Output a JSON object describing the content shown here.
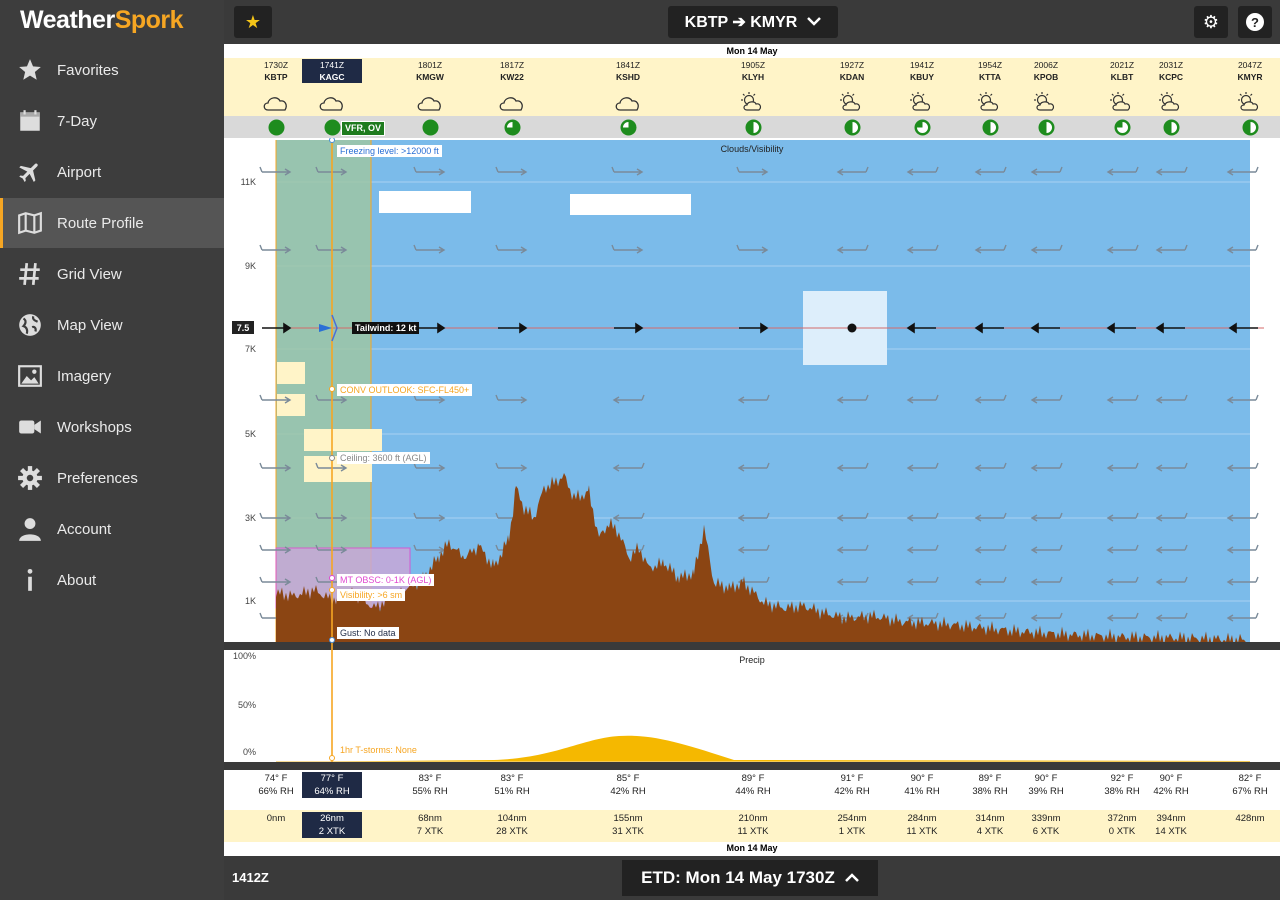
{
  "app": {
    "logo_part1": "Weather",
    "logo_part2": "Spork"
  },
  "sidebar": {
    "items": [
      {
        "label": "Favorites",
        "icon": "star-icon"
      },
      {
        "label": "7-Day",
        "icon": "calendar-icon"
      },
      {
        "label": "Airport",
        "icon": "plane-icon"
      },
      {
        "label": "Route Profile",
        "icon": "map-icon",
        "active": true
      },
      {
        "label": "Grid View",
        "icon": "hash-icon"
      },
      {
        "label": "Map View",
        "icon": "globe-icon"
      },
      {
        "label": "Imagery",
        "icon": "image-icon"
      },
      {
        "label": "Workshops",
        "icon": "video-icon"
      },
      {
        "label": "Preferences",
        "icon": "gear-icon"
      },
      {
        "label": "Account",
        "icon": "user-icon"
      },
      {
        "label": "About",
        "icon": "info-icon"
      }
    ]
  },
  "topbar": {
    "star": "★",
    "route": "KBTP ➔ KMYR",
    "gear": "⚙",
    "help": "?"
  },
  "profile": {
    "date_top": "Mon 14 May",
    "date_bottom": "Mon 14 May",
    "waypoints": [
      {
        "time": "1730Z",
        "code": "KBTP",
        "temp": "74° F",
        "rh": "66% RH",
        "dist": "0nm",
        "xtk": ""
      },
      {
        "time": "1741Z",
        "code": "KAGC",
        "temp": "77° F",
        "rh": "64% RH",
        "dist": "26nm",
        "xtk": "2 XTK",
        "selected": true
      },
      {
        "time": "1801Z",
        "code": "KMGW",
        "temp": "83° F",
        "rh": "55% RH",
        "dist": "68nm",
        "xtk": "7 XTK"
      },
      {
        "time": "1817Z",
        "code": "KW22",
        "temp": "83° F",
        "rh": "51% RH",
        "dist": "104nm",
        "xtk": "28 XTK"
      },
      {
        "time": "1841Z",
        "code": "KSHD",
        "temp": "85° F",
        "rh": "42% RH",
        "dist": "155nm",
        "xtk": "31 XTK"
      },
      {
        "time": "1905Z",
        "code": "KLYH",
        "temp": "89° F",
        "rh": "44% RH",
        "dist": "210nm",
        "xtk": "11 XTK"
      },
      {
        "time": "1927Z",
        "code": "KDAN",
        "temp": "91° F",
        "rh": "42% RH",
        "dist": "254nm",
        "xtk": "1 XTK"
      },
      {
        "time": "1941Z",
        "code": "KBUY",
        "temp": "90° F",
        "rh": "41% RH",
        "dist": "284nm",
        "xtk": "11 XTK"
      },
      {
        "time": "1954Z",
        "code": "KTTA",
        "temp": "89° F",
        "rh": "38% RH",
        "dist": "314nm",
        "xtk": "4 XTK"
      },
      {
        "time": "2006Z",
        "code": "KPOB",
        "temp": "90° F",
        "rh": "39% RH",
        "dist": "339nm",
        "xtk": "6 XTK"
      },
      {
        "time": "2021Z",
        "code": "KLBT",
        "temp": "92° F",
        "rh": "38% RH",
        "dist": "372nm",
        "xtk": "0 XTK"
      },
      {
        "time": "2031Z",
        "code": "KCPC",
        "temp": "90° F",
        "rh": "42% RH",
        "dist": "394nm",
        "xtk": "14 XTK"
      },
      {
        "time": "2047Z",
        "code": "KMYR",
        "temp": "82° F",
        "rh": "67% RH",
        "dist": "428nm",
        "xtk": ""
      }
    ],
    "flight_category": "VFR, OV",
    "cloud_vis_title": "Clouds/Visibility",
    "precip_title": "Precip",
    "altitude_ticks": [
      "11K",
      "9K",
      "7K",
      "5K",
      "3K",
      "1K"
    ],
    "cruise_alt": "7.5",
    "precip_ticks": [
      "100%",
      "50%",
      "0%"
    ],
    "tags": {
      "freezing": "Freezing level: >12000 ft",
      "tailwind": "Tailwind: 12 kt",
      "conv": "CONV OUTLOOK: SFC-FL450+",
      "ceiling": "Ceiling: 3600 ft (AGL)",
      "mt_obsc": "MT OBSC: 0-1K (AGL)",
      "visibility": "Visibility: >6 sm",
      "gust": "Gust: No data",
      "tstorms": "1hr T-storms: None"
    }
  },
  "bottom": {
    "time": "1412Z",
    "etd": "ETD: Mon 14 May 1730Z",
    "chevron": "⌃"
  },
  "colors": {
    "sky": "#7bbbea",
    "terrain": "#8b4513",
    "precip": "#f5b800",
    "accent": "#f6a623",
    "cruise": "#d46a6a"
  }
}
